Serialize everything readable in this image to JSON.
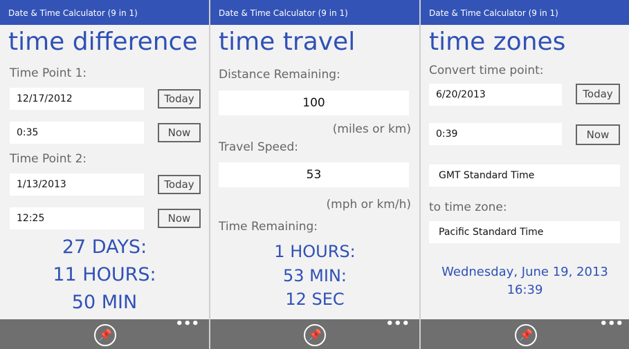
{
  "app_title": "Date & Time Calculator (9 in 1)",
  "panel1": {
    "heading": "time difference",
    "time_point_1_label": "Time Point 1:",
    "date1": "12/17/2012",
    "today1": "Today",
    "time1": "0:35",
    "now1": "Now",
    "time_point_2_label": "Time Point 2:",
    "date2": "1/13/2013",
    "today2": "Today",
    "time2": "12:25",
    "now2": "Now",
    "result_days": "27 DAYS:",
    "result_hours": "11 HOURS:",
    "result_min": "50 MIN"
  },
  "panel2": {
    "heading": "time travel",
    "distance_label": "Distance Remaining:",
    "distance_value": "100",
    "distance_unit": "(miles or km)",
    "speed_label": "Travel Speed:",
    "speed_value": "53",
    "speed_unit": "(mph or km/h)",
    "remaining_label": "Time Remaining:",
    "result_hours": "1 HOURS:",
    "result_min": "53 MIN:",
    "result_sec": "12 SEC"
  },
  "panel3": {
    "heading": "time zones",
    "convert_label": "Convert time point:",
    "date": "6/20/2013",
    "today": "Today",
    "time": "0:39",
    "now": "Now",
    "from_zone": "GMT Standard Time",
    "to_label": "to time zone:",
    "to_zone": "Pacific Standard Time",
    "result_date": "Wednesday, June 19, 2013",
    "result_time": "16:39"
  },
  "appbar": {
    "pin_icon": "pin-icon",
    "more_icon": "more-icon",
    "more_glyph": "•••"
  },
  "colors": {
    "accent": "#2f51b6",
    "titlebar": "#3354b6",
    "appbar": "#6f6f6f"
  }
}
